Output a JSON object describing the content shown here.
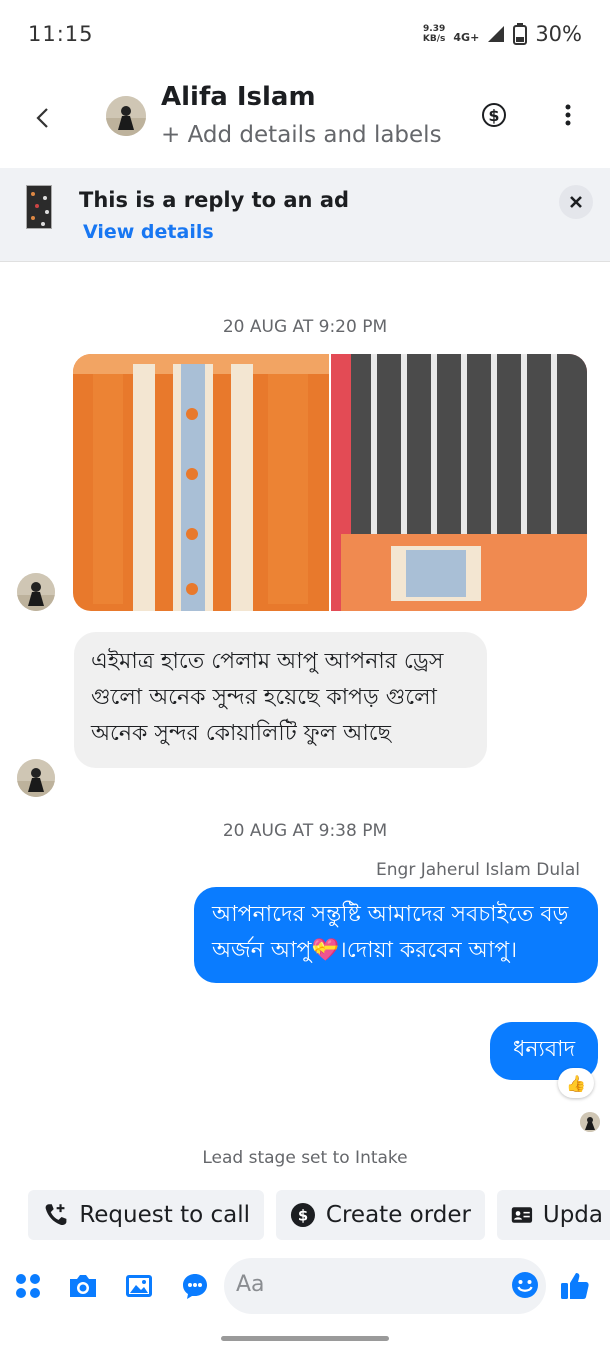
{
  "status": {
    "time": "11:15",
    "net_speed_value": "9.39",
    "net_speed_unit": "KB/s",
    "network": "4G+",
    "battery": "30%"
  },
  "header": {
    "name": "Alifa Islam",
    "subtitle": "+ Add details and labels"
  },
  "ad_banner": {
    "title": "This is a reply to an ad",
    "link": "View details"
  },
  "messages": {
    "timestamp_1": "20 AUG AT 9:20 PM",
    "incoming_text": "এইমাত্র হাতে পেলাম আপু আপনার ড্রেস গুলো অনেক সুন্দর হয়েছে কাপড় গুলো অনেক সুন্দর কোয়ালিটি ফুল আছে",
    "timestamp_2": "20 AUG AT 9:38 PM",
    "sender_label": "Engr Jaherul Islam Dulal",
    "outgoing_1": "আপনাদের সন্তুষ্টি আমাদের সবচাইতে বড় অর্জন  আপু💝।দোয়া করবেন আপু।",
    "outgoing_2": "ধন্যবাদ",
    "reaction": "👍"
  },
  "lead_stage": "Lead stage set to Intake",
  "quick_actions": [
    {
      "label": "Request to call",
      "icon": "phone-plus-icon"
    },
    {
      "label": "Create order",
      "icon": "dollar-circle-icon"
    },
    {
      "label": "Upda",
      "icon": "id-card-icon"
    }
  ],
  "composer": {
    "placeholder": "Aa"
  },
  "colors": {
    "accent": "#0a7cff",
    "link": "#1877f2",
    "bubble_in": "#f0f0f0",
    "banner_bg": "#f0f2f5"
  }
}
